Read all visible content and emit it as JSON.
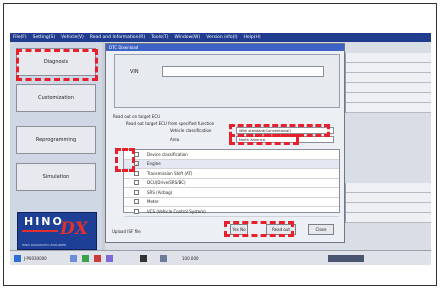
{
  "menu": [
    "File(F)",
    "Setting(S)",
    "Vehicle(V)",
    "Read and Information(R)",
    "Tools(T)",
    "Window(W)",
    "Version info(I)",
    "Help(H)"
  ],
  "sidebar": {
    "buttons": [
      "Diagnosis",
      "Customization",
      "Reprogramming",
      "Simulation"
    ],
    "logo": {
      "word": "HINO",
      "mark": "DX",
      "tagline": "HINO DIAGNOSTIC EXPLORER"
    }
  },
  "dialog": {
    "title": "DTC Download",
    "vin_label": "VIN",
    "vin_value": "",
    "section_title": "Read out on target ECU",
    "subsection": "Read out target ECU from specified function",
    "vehicle_classification_label": "Vehicle classification",
    "vehicle_classification_value": "With standard(Conventional)",
    "area_label": "Area",
    "area_value": "North America",
    "list_items": [
      {
        "label": "Device classification",
        "selected": false
      },
      {
        "label": "Engine",
        "selected": true
      },
      {
        "label": "Transmission Shift (AT)",
        "selected": false
      },
      {
        "label": "DCU(Drive/SRS/BC)",
        "selected": false
      },
      {
        "label": "SRS (Airbag)",
        "selected": false
      },
      {
        "label": "Meter",
        "selected": false
      },
      {
        "label": "VCS (Vehicle Control System)",
        "selected": false
      }
    ],
    "upload_label": "Upload ISF file",
    "buttons": {
      "yes_no": "Yes No",
      "read_out": "Read out",
      "close": "Close"
    }
  },
  "taskbar": {
    "status": "J-P0030000",
    "text": "100.000"
  },
  "colors": {
    "highlight": "#e8202b",
    "menubar": "#1f3c8f",
    "logo_bg": "#1d3f95"
  }
}
